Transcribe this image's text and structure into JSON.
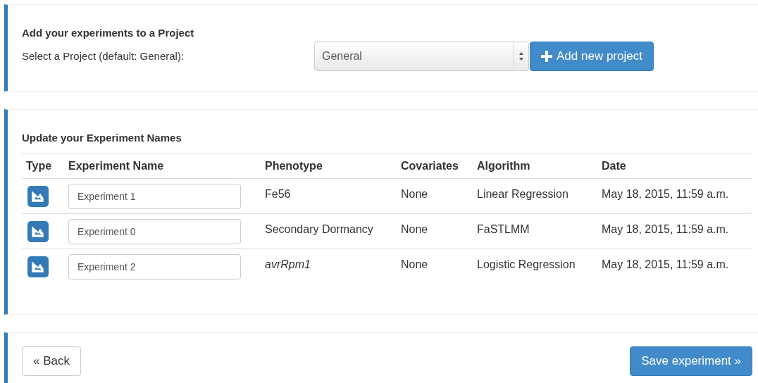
{
  "project_panel": {
    "title": "Add your experiments to a Project",
    "select_label": "Select a Project (default: General):",
    "select_value": "General",
    "add_button": "Add new project"
  },
  "experiments_panel": {
    "title": "Update your Experiment Names",
    "columns": [
      "Type",
      "Experiment Name",
      "Phenotype",
      "Covariates",
      "Algorithm",
      "Date"
    ],
    "rows": [
      {
        "name": "Experiment 1",
        "phenotype": "Fe56",
        "phenotype_italic": false,
        "covariates": "None",
        "algorithm": "Linear Regression",
        "date": "May 18, 2015, 11:59 a.m."
      },
      {
        "name": "Experiment 0",
        "phenotype": "Secondary Dormancy",
        "phenotype_italic": false,
        "covariates": "None",
        "algorithm": "FaSTLMM",
        "date": "May 18, 2015, 11:59 a.m."
      },
      {
        "name": "Experiment 2",
        "phenotype": "avrRpm1",
        "phenotype_italic": true,
        "covariates": "None",
        "algorithm": "Logistic Regression",
        "date": "May 18, 2015, 11:59 a.m."
      }
    ]
  },
  "footer": {
    "back_button": "« Back",
    "save_button": "Save experiment »"
  }
}
